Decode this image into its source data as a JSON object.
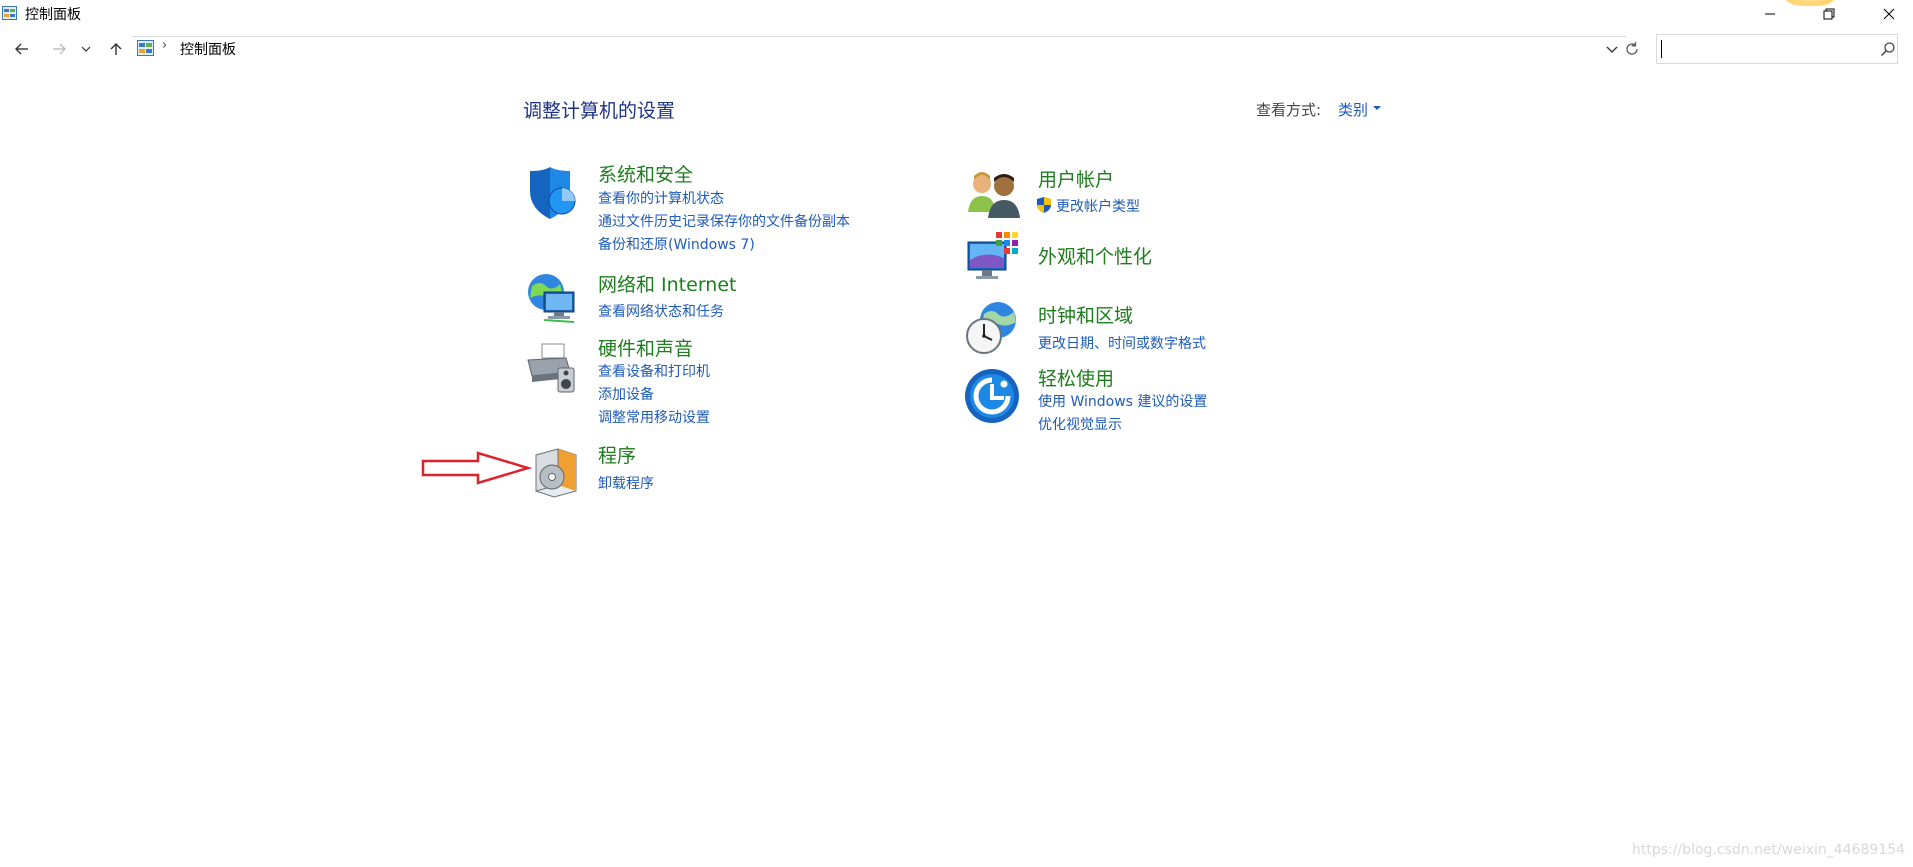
{
  "window": {
    "title": "控制面板"
  },
  "address_bar": {
    "path": "控制面板",
    "search_placeholder": ""
  },
  "content": {
    "heading": "调整计算机的设置",
    "view_by_label": "查看方式:",
    "view_by_value": "类别"
  },
  "categories_left": [
    {
      "title": "系统和安全",
      "links": [
        "查看你的计算机状态",
        "通过文件历史记录保存你的文件备份副本",
        "备份和还原(Windows 7)"
      ]
    },
    {
      "title": "网络和 Internet",
      "links": [
        "查看网络状态和任务"
      ]
    },
    {
      "title": "硬件和声音",
      "links": [
        "查看设备和打印机",
        "添加设备",
        "调整常用移动设置"
      ]
    },
    {
      "title": "程序",
      "links": [
        "卸载程序"
      ]
    }
  ],
  "categories_right": [
    {
      "title": "用户帐户",
      "links": [
        "更改帐户类型"
      ]
    },
    {
      "title": "外观和个性化",
      "links": []
    },
    {
      "title": "时钟和区域",
      "links": [
        "更改日期、时间或数字格式"
      ]
    },
    {
      "title": "轻松使用",
      "links": [
        "使用 Windows 建议的设置",
        "优化视觉显示"
      ]
    }
  ],
  "watermark": "https://blog.csdn.net/weixin_44689154",
  "colors": {
    "heading": "#1e3287",
    "category_title": "#1e7d1e",
    "link": "#1e5bb8",
    "annotation_arrow": "#e0202a"
  }
}
